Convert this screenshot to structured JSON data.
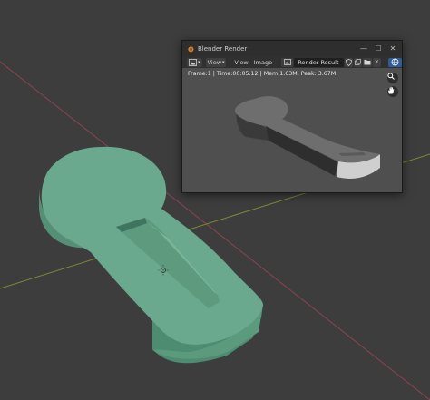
{
  "render_window": {
    "title": "Blender Render",
    "controls": {
      "minimize": "—",
      "maximize": "☐",
      "close": "✕"
    },
    "menus": [
      "View",
      "View",
      "Image"
    ],
    "slot_value": "Render Result",
    "frame_info": "Frame:1 | Time:00:05.12 | Mem:1.63M, Peak: 3.67M"
  },
  "icons": {
    "editor_type": "image-editor-icon",
    "slot_type": "image-slot-icon",
    "fake_user": "shield-icon",
    "copy": "duplicate-icon",
    "open": "folder-icon",
    "unlink": "close-icon",
    "zoom": "zoom-icon",
    "pan": "hand-icon"
  },
  "colors": {
    "viewport_bg": "#3d3d3d",
    "model_green": "#6aa98d",
    "window_bg": "#2b2b2b",
    "render_bg": "#4f4f4f",
    "axis_red": "#9a4a55",
    "axis_green": "#7a8a34"
  }
}
